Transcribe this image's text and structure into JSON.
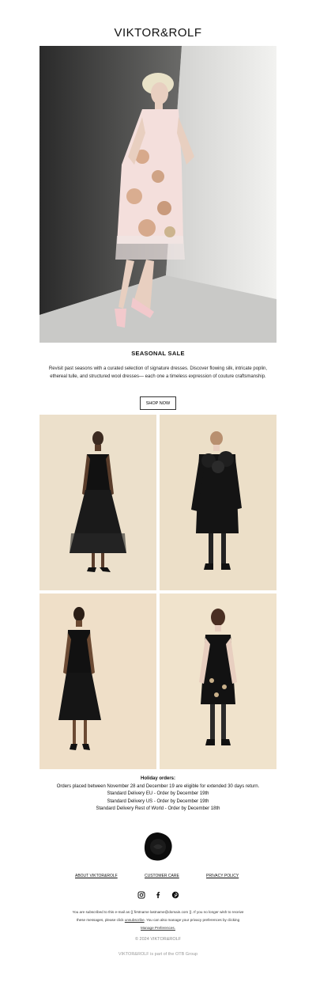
{
  "header": {
    "logo": "VIKTOR&ROLF"
  },
  "hero": {
    "alt": "Model in pale pink floral embellished dress"
  },
  "sale": {
    "title": "SEASONAL SALE",
    "description": "Revisit past seasons with a curated selection of signature dresses. Discover flowing silk, intricate poplin, ethereal tulle, and structured wool dresses— each one a timeless expression of couture craftsmanship.",
    "button": "SHOP NOW"
  },
  "holiday": {
    "title": "Holiday orders:",
    "lines": [
      "Orders placed between November 28 and December 19 are eligible for extended 30 days return.",
      "Standard Delivery EU - Order by December 19th",
      "Standard Delivery US - Order by December 19th",
      "Standard Delivery Rest of World - Order by December 18th"
    ]
  },
  "footer": {
    "links": [
      "ABOUT VIKTOR&ROLF",
      "CUSTOMER CARE",
      "PRIVACY POLICY"
    ],
    "social_icons": [
      "instagram-icon",
      "facebook-icon",
      "pinterest-icon"
    ],
    "subscribe_text_1": "You are subscribed to this e-mail as {{ firstname lastname@domain.com }}. If you no longer wish to receive these messages, please click",
    "unsubscribe": "unsubscribe",
    "subscribe_text_2": ". You can also manage your privacy preferences by clicking",
    "manage": "Manage Preferences.",
    "copyright": "© 2024 VIKTOR&ROLF",
    "group": "VIKTOR&ROLF is part of the OTB Group"
  },
  "colors": {
    "grid_bg": "#ece0cb",
    "hero_bg": "#d8d8d6",
    "text": "#111111",
    "muted": "#888888"
  }
}
